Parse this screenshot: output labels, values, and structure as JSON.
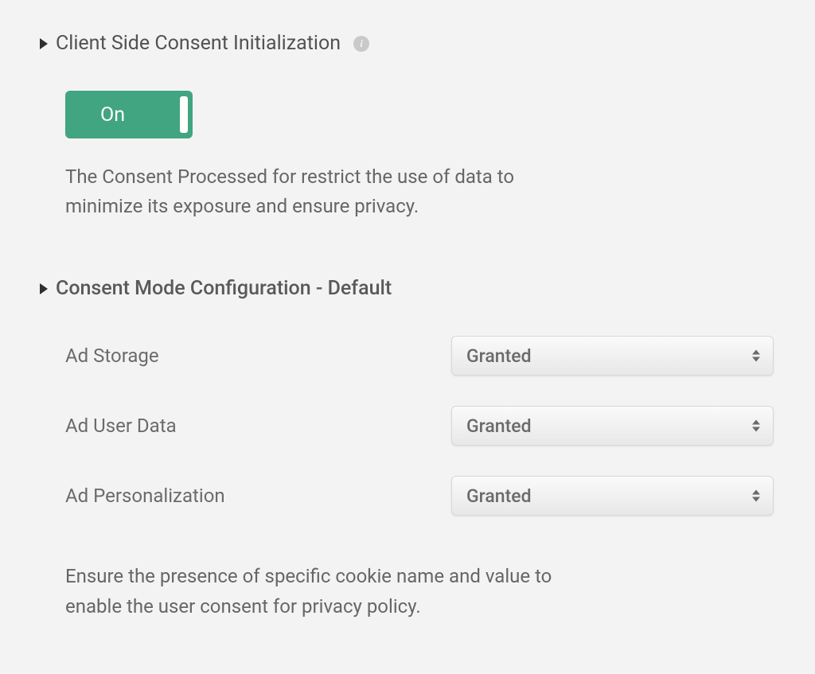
{
  "section1": {
    "title": "Client Side Consent Initialization",
    "toggle": {
      "label": "On",
      "state": true
    },
    "description": "The Consent Processed for restrict the use of data to minimize its exposure and ensure privacy."
  },
  "section2": {
    "title": "Consent Mode Configuration - Default",
    "fields": [
      {
        "label": "Ad Storage",
        "value": "Granted"
      },
      {
        "label": "Ad User Data",
        "value": "Granted"
      },
      {
        "label": "Ad Personalization",
        "value": "Granted"
      }
    ],
    "description": "Ensure the presence of specific cookie name and value to enable the user consent for privacy policy."
  }
}
